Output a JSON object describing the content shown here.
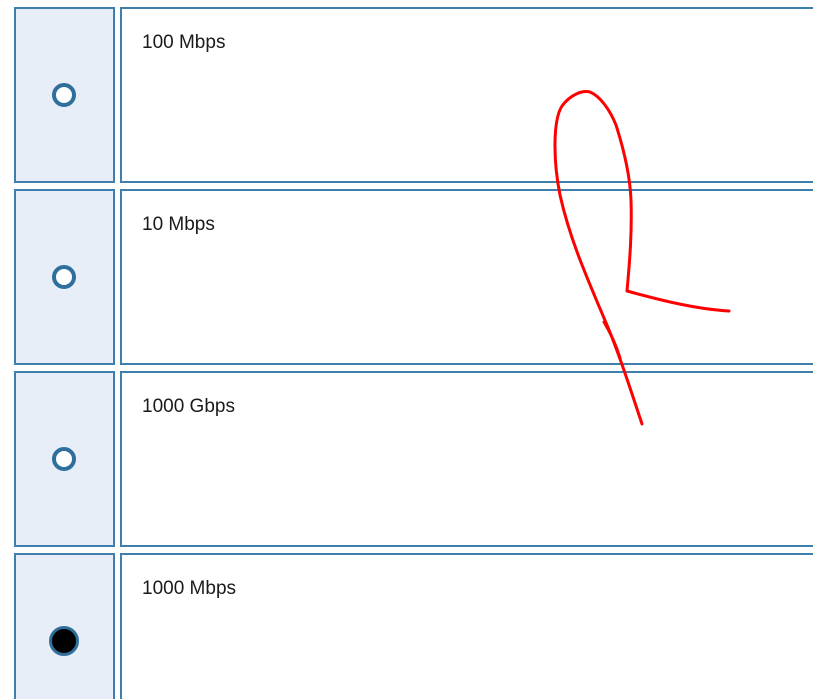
{
  "options": [
    {
      "label": "100 Mbps",
      "selected": false
    },
    {
      "label": "10 Mbps",
      "selected": false
    },
    {
      "label": "1000 Gbps",
      "selected": false
    },
    {
      "label": "1000 Mbps",
      "selected": true
    }
  ],
  "colors": {
    "border": "#3f7fad",
    "radio_cell_bg": "#e8eef7",
    "radio_ring": "#2f6f9c",
    "annotation": "#ff0000"
  }
}
